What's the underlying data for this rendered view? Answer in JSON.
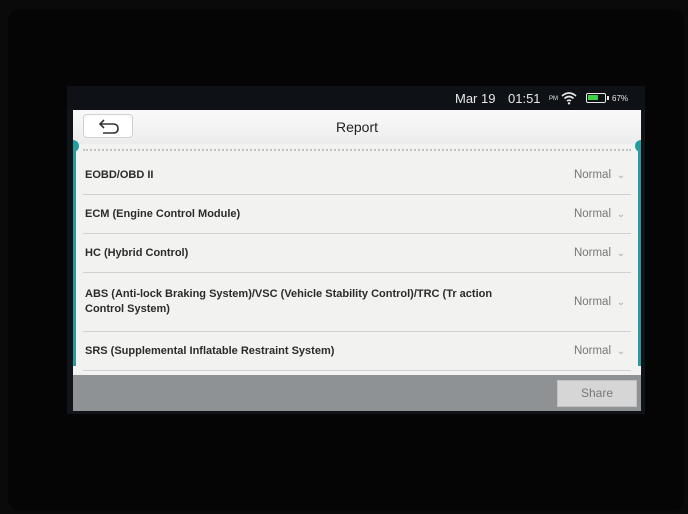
{
  "status": {
    "date": "Mar 19",
    "time": "01:51",
    "ampm": "PM",
    "wifi_icon": "wifi-icon",
    "battery_icon": "battery-icon",
    "battery_level": 0.67,
    "battery_text": "67%"
  },
  "header": {
    "back_icon": "back-arrow-icon",
    "title": "Report"
  },
  "rows": [
    {
      "name": "EOBD/OBD II",
      "status": "Normal"
    },
    {
      "name": "ECM (Engine Control Module)",
      "status": "Normal"
    },
    {
      "name": "HC (Hybrid Control)",
      "status": "Normal"
    },
    {
      "name": "ABS (Anti-lock Braking System)/VSC (Vehicle Stability Control)/TRC (Tr action Control System)",
      "status": "Normal"
    },
    {
      "name": "SRS (Supplemental Inflatable Restraint System)",
      "status": "Normal"
    }
  ],
  "footer": {
    "share_label": "Share"
  },
  "colors": {
    "accent": "#1f9ea0",
    "battery_green": "#3dd14a"
  }
}
